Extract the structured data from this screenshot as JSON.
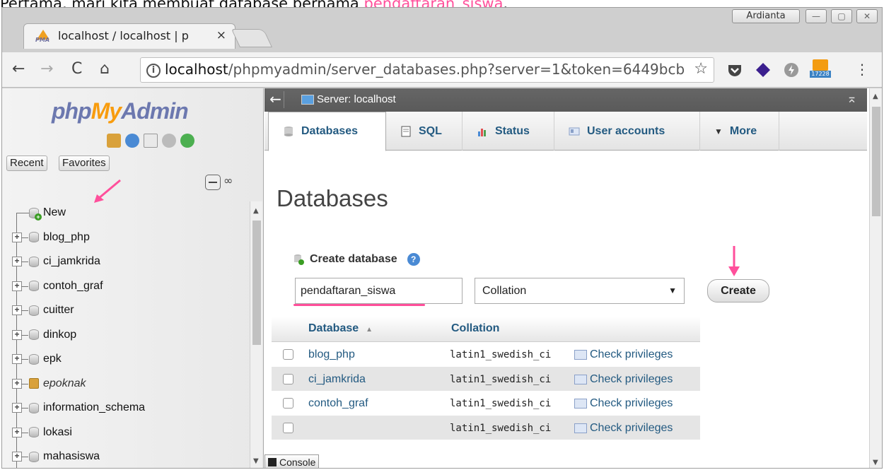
{
  "caption": {
    "before": "Pertama, mari kita membuat database bernama ",
    "highlight": "pendaftaran_siswa",
    "after": "."
  },
  "browser": {
    "tab_title": "localhost / localhost | p",
    "tab_close": "×",
    "profile_name": "Ardianta",
    "url_host": "localhost",
    "url_path": "/phpmyadmin/server_databases.php?server=1&token=6449bcb(",
    "star": "☆",
    "rss_badge": "17228",
    "menu": "⋮"
  },
  "sidebar": {
    "logo_php": "php",
    "logo_my": "My",
    "logo_admin": "Admin",
    "recent_label": "Recent",
    "favorites_label": "Favorites",
    "tree_items": [
      {
        "label": "New",
        "italic": false
      },
      {
        "label": "blog_php",
        "italic": false
      },
      {
        "label": "ci_jamkrida",
        "italic": false
      },
      {
        "label": "contoh_graf",
        "italic": false
      },
      {
        "label": "cuitter",
        "italic": false
      },
      {
        "label": "dinkop",
        "italic": false
      },
      {
        "label": "epk",
        "italic": false
      },
      {
        "label": "epoknak",
        "italic": true
      },
      {
        "label": "information_schema",
        "italic": false
      },
      {
        "label": "lokasi",
        "italic": false
      },
      {
        "label": "mahasiswa",
        "italic": false
      }
    ]
  },
  "main": {
    "server_label": "Server: localhost",
    "tabs": [
      {
        "label": "Databases"
      },
      {
        "label": "SQL"
      },
      {
        "label": "Status"
      },
      {
        "label": "User accounts"
      },
      {
        "label": "More"
      }
    ],
    "page_title": "Databases",
    "create_db_label": "Create database",
    "db_name_value": "pendaftaran_siswa",
    "collation_placeholder": "Collation",
    "create_button": "Create",
    "table_headers": {
      "database": "Database",
      "collation": "Collation"
    },
    "rows": [
      {
        "db": "blog_php",
        "collation": "latin1_swedish_ci",
        "action": "Check privileges"
      },
      {
        "db": "ci_jamkrida",
        "collation": "latin1_swedish_ci",
        "action": "Check privileges"
      },
      {
        "db": "contoh_graf",
        "collation": "latin1_swedish_ci",
        "action": "Check privileges"
      },
      {
        "db": "",
        "collation": "latin1_swedish_ci",
        "action": "Check privileges"
      }
    ],
    "console_label": "Console"
  },
  "colors": {
    "annotation_pink": "#ff4f9b",
    "link_blue": "#235a81",
    "logo_blue": "#6c78af",
    "logo_orange": "#f89c0e"
  }
}
